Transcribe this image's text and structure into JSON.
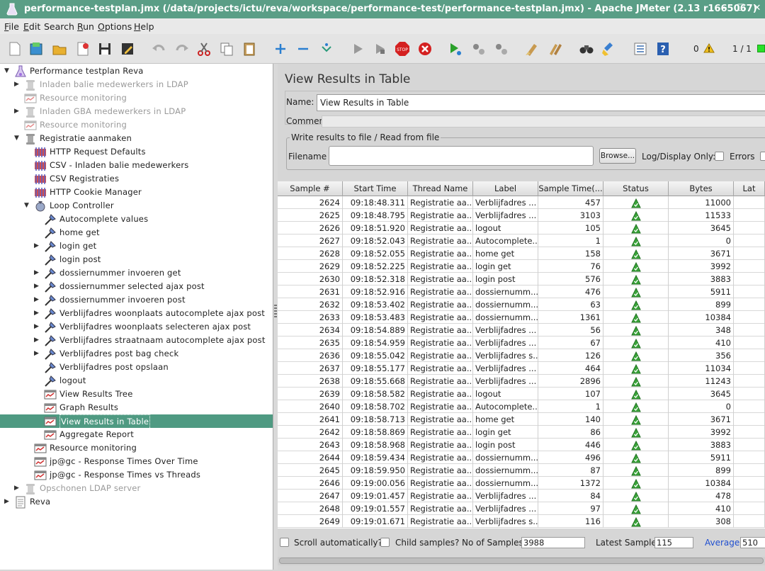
{
  "window": {
    "title": "performance-testplan.jmx (/data/projects/ictu/reva/workspace/performance-test/performance-testplan.jmx) - Apache JMeter (2.13 r1665067)",
    "minimize": "–",
    "maximize": "☐",
    "close": "✕"
  },
  "menu": [
    {
      "label": "File",
      "mnemonic": "F",
      "rest": "ile"
    },
    {
      "label": "Edit",
      "mnemonic": "E",
      "rest": "dit"
    },
    {
      "label": "Search",
      "mnemonic": "",
      "rest": "Search"
    },
    {
      "label": "Run",
      "mnemonic": "R",
      "rest": "un"
    },
    {
      "label": "Options",
      "mnemonic": "O",
      "rest": "ptions"
    },
    {
      "label": "Help",
      "mnemonic": "H",
      "rest": "elp"
    }
  ],
  "toolbar": {
    "buttons": [
      "new-icon",
      "templates-icon",
      "open-icon",
      "close-icon",
      "save-icon",
      "save-as-icon",
      "undo-icon",
      "redo-icon",
      "cut-icon",
      "copy-icon",
      "paste-icon",
      "expand-icon",
      "collapse-icon",
      "toggle-icon",
      "start-icon",
      "start-no-pause-icon",
      "stop-icon",
      "shutdown-icon",
      "remote-start-icon",
      "remote-stop-icon",
      "remote-shutdown-icon",
      "clear-icon",
      "clear-all-icon",
      "search-icon",
      "reset-search-icon",
      "function-helper-icon",
      "help-icon"
    ],
    "error_count": "0",
    "thread_count": "1 / 1"
  },
  "tree": [
    {
      "label": "Performance testplan Reva",
      "icon": "flask-icon"
    },
    {
      "label": "Inladen balie medewerkers in LDAP",
      "icon": "thread-group-icon"
    },
    {
      "label": "Resource monitoring",
      "icon": "listener-icon"
    },
    {
      "label": "Inladen GBA medewerkers in LDAP",
      "icon": "thread-group-icon"
    },
    {
      "label": "Resource monitoring",
      "icon": "listener-icon"
    },
    {
      "label": "Registratie aanmaken",
      "icon": "thread-group-icon"
    },
    {
      "label": "HTTP Request Defaults",
      "icon": "config-icon"
    },
    {
      "label": "CSV - Inladen balie medewerkers",
      "icon": "config-icon"
    },
    {
      "label": "CSV Registraties",
      "icon": "config-icon"
    },
    {
      "label": "HTTP Cookie Manager",
      "icon": "config-icon"
    },
    {
      "label": "Loop Controller",
      "icon": "loop-icon"
    },
    {
      "label": "Autocomplete values",
      "icon": "sampler-icon"
    },
    {
      "label": "home get",
      "icon": "sampler-icon"
    },
    {
      "label": "login get",
      "icon": "sampler-icon"
    },
    {
      "label": "login post",
      "icon": "sampler-icon"
    },
    {
      "label": "dossiernummer invoeren get",
      "icon": "sampler-icon"
    },
    {
      "label": "dossiernummer selected ajax post",
      "icon": "sampler-icon"
    },
    {
      "label": "dossiernummer invoeren post",
      "icon": "sampler-icon"
    },
    {
      "label": "Verblijfadres woonplaats autocomplete ajax post",
      "icon": "sampler-icon"
    },
    {
      "label": "Verblijfadres woonplaats selecteren ajax post",
      "icon": "sampler-icon"
    },
    {
      "label": "Verblijfadres straatnaam autocomplete ajax post",
      "icon": "sampler-icon"
    },
    {
      "label": "Verblijfadres post bag check",
      "icon": "sampler-icon"
    },
    {
      "label": "Verblijfadres post opslaan",
      "icon": "sampler-icon"
    },
    {
      "label": "logout",
      "icon": "sampler-icon"
    },
    {
      "label": "View Results Tree",
      "icon": "listener-icon"
    },
    {
      "label": "Graph Results",
      "icon": "listener-icon"
    },
    {
      "label": "View Results in Table",
      "icon": "listener-icon"
    },
    {
      "label": "Aggregate Report",
      "icon": "listener-icon"
    },
    {
      "label": "Resource monitoring",
      "icon": "listener-icon"
    },
    {
      "label": "jp@gc - Response Times Over Time",
      "icon": "listener-icon"
    },
    {
      "label": "jp@gc - Response Times vs Threads",
      "icon": "listener-icon"
    },
    {
      "label": "Opschonen LDAP server",
      "icon": "thread-group-icon"
    },
    {
      "label": "Reva",
      "icon": "workbench-icon"
    }
  ],
  "panel": {
    "title": "View Results in Table",
    "name_label": "Name:",
    "name_value": "View Results in Table",
    "comments_label": "Comments:",
    "file_legend": "Write results to file / Read from file",
    "filename_label": "Filename",
    "browse_label": "Browse...",
    "log_display_label": "Log/Display Only:",
    "errors_label": "Errors"
  },
  "table": {
    "columns": [
      "Sample #",
      "Start Time",
      "Thread Name",
      "Label",
      "Sample Time(...",
      "Status",
      "Bytes",
      "Lat"
    ],
    "rows": [
      [
        "2624",
        "09:18:48.311",
        "Registratie aa...",
        "Verblijfadres ...",
        "457",
        "success",
        "11000"
      ],
      [
        "2625",
        "09:18:48.795",
        "Registratie aa...",
        "Verblijfadres ...",
        "3103",
        "success",
        "11533"
      ],
      [
        "2626",
        "09:18:51.920",
        "Registratie aa...",
        "logout",
        "105",
        "success",
        "3645"
      ],
      [
        "2627",
        "09:18:52.043",
        "Registratie aa...",
        "Autocomplete...",
        "1",
        "success",
        "0"
      ],
      [
        "2628",
        "09:18:52.055",
        "Registratie aa...",
        "home get",
        "158",
        "success",
        "3671"
      ],
      [
        "2629",
        "09:18:52.225",
        "Registratie aa...",
        "login get",
        "76",
        "success",
        "3992"
      ],
      [
        "2630",
        "09:18:52.318",
        "Registratie aa...",
        "login post",
        "576",
        "success",
        "3883"
      ],
      [
        "2631",
        "09:18:52.916",
        "Registratie aa...",
        "dossiernumm...",
        "476",
        "success",
        "5911"
      ],
      [
        "2632",
        "09:18:53.402",
        "Registratie aa...",
        "dossiernumm...",
        "63",
        "success",
        "899"
      ],
      [
        "2633",
        "09:18:53.483",
        "Registratie aa...",
        "dossiernumm...",
        "1361",
        "success",
        "10384"
      ],
      [
        "2634",
        "09:18:54.889",
        "Registratie aa...",
        "Verblijfadres ...",
        "56",
        "success",
        "348"
      ],
      [
        "2635",
        "09:18:54.959",
        "Registratie aa...",
        "Verblijfadres ...",
        "67",
        "success",
        "410"
      ],
      [
        "2636",
        "09:18:55.042",
        "Registratie aa...",
        "Verblijfadres s...",
        "126",
        "success",
        "356"
      ],
      [
        "2637",
        "09:18:55.177",
        "Registratie aa...",
        "Verblijfadres ...",
        "464",
        "success",
        "11034"
      ],
      [
        "2638",
        "09:18:55.668",
        "Registratie aa...",
        "Verblijfadres ...",
        "2896",
        "success",
        "11243"
      ],
      [
        "2639",
        "09:18:58.582",
        "Registratie aa...",
        "logout",
        "107",
        "success",
        "3645"
      ],
      [
        "2640",
        "09:18:58.702",
        "Registratie aa...",
        "Autocomplete...",
        "1",
        "success",
        "0"
      ],
      [
        "2641",
        "09:18:58.713",
        "Registratie aa...",
        "home get",
        "140",
        "success",
        "3671"
      ],
      [
        "2642",
        "09:18:58.869",
        "Registratie aa...",
        "login get",
        "86",
        "success",
        "3992"
      ],
      [
        "2643",
        "09:18:58.968",
        "Registratie aa...",
        "login post",
        "446",
        "success",
        "3883"
      ],
      [
        "2644",
        "09:18:59.434",
        "Registratie aa...",
        "dossiernumm...",
        "496",
        "success",
        "5911"
      ],
      [
        "2645",
        "09:18:59.950",
        "Registratie aa...",
        "dossiernumm...",
        "87",
        "success",
        "899"
      ],
      [
        "2646",
        "09:19:00.056",
        "Registratie aa...",
        "dossiernumm...",
        "1372",
        "success",
        "10384"
      ],
      [
        "2647",
        "09:19:01.457",
        "Registratie aa...",
        "Verblijfadres ...",
        "84",
        "success",
        "478"
      ],
      [
        "2648",
        "09:19:01.557",
        "Registratie aa...",
        "Verblijfadres ...",
        "97",
        "success",
        "410"
      ],
      [
        "2649",
        "09:19:01.671",
        "Registratie aa...",
        "Verblijfadres s...",
        "116",
        "success",
        "308"
      ]
    ]
  },
  "footer": {
    "scroll_auto_label": "Scroll automatically?",
    "child_samples_label": "Child samples?",
    "no_samples_label": "No of Samples",
    "no_samples_value": "3988",
    "latest_sample_label": "Latest Sample",
    "latest_sample_value": "115",
    "average_label": "Average",
    "average_value": "510"
  },
  "colors": {
    "titlebar": "#5a9e86",
    "selection": "#4f9a82",
    "average_link": "#1f4fd0",
    "status_success": "#3aa63a"
  }
}
